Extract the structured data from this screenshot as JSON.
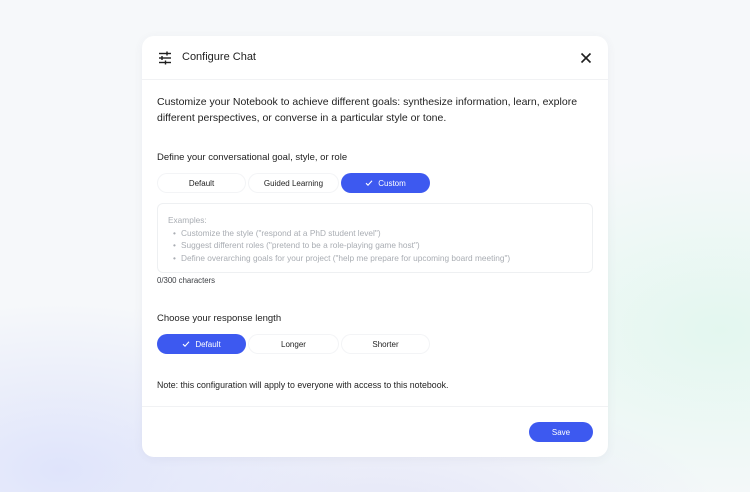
{
  "dialog": {
    "title": "Configure Chat",
    "header_icon": "tune-icon",
    "close_icon": "close-icon",
    "intro": "Customize your Notebook to achieve different goals: synthesize information, learn, explore different perspectives, or converse in a particular style or tone.",
    "goal_section": {
      "label": "Define your conversational goal, style, or role",
      "options": [
        {
          "label": "Default",
          "selected": false
        },
        {
          "label": "Guided Learning",
          "selected": false
        },
        {
          "label": "Custom",
          "selected": true
        }
      ],
      "textarea": {
        "placeholder_heading": "Examples:",
        "placeholder_items": [
          "Customize the style (\"respond at a PhD student level\")",
          "Suggest different roles (\"pretend to be a role-playing game host\")",
          "Define overarching goals for your project (\"help me prepare for upcoming board meeting\")"
        ],
        "value": ""
      },
      "counter": "0/300 characters"
    },
    "length_section": {
      "label": "Choose your response length",
      "options": [
        {
          "label": "Default",
          "selected": true
        },
        {
          "label": "Longer",
          "selected": false
        },
        {
          "label": "Shorter",
          "selected": false
        }
      ]
    },
    "note": "Note: this configuration will apply to everyone with access to this notebook.",
    "save_label": "Save"
  },
  "colors": {
    "accent": "#3d59f0",
    "text": "#1f1f1f",
    "placeholder": "#a9adb3"
  }
}
